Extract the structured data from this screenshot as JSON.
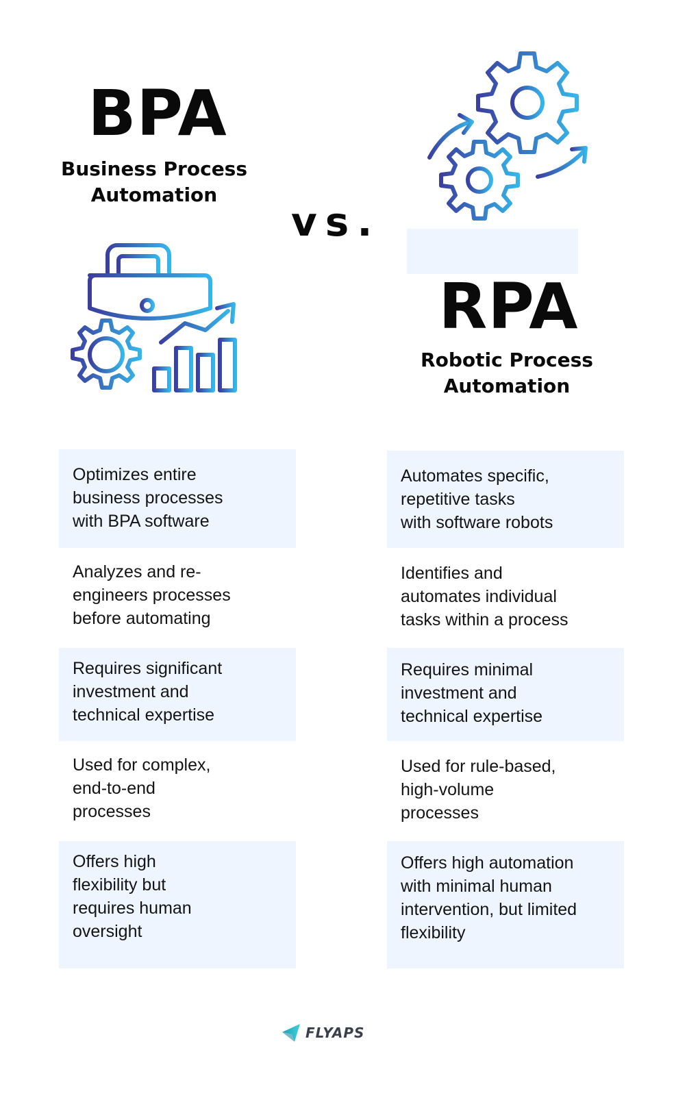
{
  "left": {
    "acronym": "BPA",
    "full_name": "Business Process\nAutomation",
    "icon": "briefcase-gear-chart-icon"
  },
  "vs_label": "vs.",
  "right": {
    "acronym": "RPA",
    "full_name": "Robotic Process\nAutomation",
    "icon": "gears-arrows-icon"
  },
  "rows": [
    {
      "bpa": "Optimizes entire\nbusiness processes\nwith BPA software",
      "rpa": "Automates specific,\nrepetitive tasks\nwith software robots",
      "shaded": true
    },
    {
      "bpa": "Analyzes and re-\nengineers processes\nbefore automating",
      "rpa": "Identifies and\nautomates individual\ntasks within a process",
      "shaded": false
    },
    {
      "bpa": "Requires significant\ninvestment and\ntechnical expertise",
      "rpa": "Requires minimal\ninvestment and\ntechnical expertise",
      "shaded": true
    },
    {
      "bpa": "Used for complex,\nend-to-end\nprocesses",
      "rpa": "Used for rule-based,\nhigh-volume\nprocesses",
      "shaded": false
    },
    {
      "bpa": "Offers high\nflexibility but\nrequires human\noversight",
      "rpa": "Offers high automation\nwith minimal human\nintervention, but limited\nflexibility",
      "shaded": true
    }
  ],
  "footer": {
    "brand": "FLYAPS",
    "icon": "paper-plane-logo-icon"
  },
  "colors": {
    "gradient_start": "#3a3fa0",
    "gradient_end": "#35b6ea",
    "cell_bg": "#eef5fe",
    "logo_teal": "#1fb5c6"
  }
}
